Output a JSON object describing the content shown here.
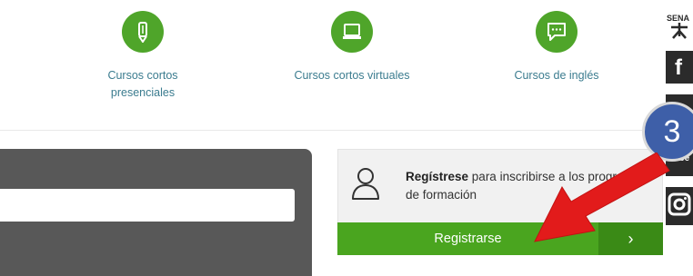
{
  "courses": [
    {
      "label_line1": "Cursos cortos",
      "label_line2": "presenciales",
      "icon": "pencil-icon"
    },
    {
      "label_line1": "Cursos cortos virtuales",
      "label_line2": "",
      "icon": "laptop-icon"
    },
    {
      "label_line1": "Cursos de inglés",
      "label_line2": "",
      "icon": "chat-icon"
    }
  ],
  "register": {
    "bold": "Regístrese",
    "rest": " para inscribirse a los programas de formación",
    "button_label": "Registrarse",
    "arrow_label": "›"
  },
  "social": {
    "logo_text": "SENA",
    "facebook": "f",
    "youtube": "Tube",
    "instagram": "Instagram"
  },
  "annotation": {
    "step": "3"
  },
  "colors": {
    "green": "#4fa52a",
    "dark_green": "#3a8a16",
    "badge_blue": "#3e5fa8",
    "arrow_red": "#e21b1b",
    "panel_grey": "#585858"
  }
}
